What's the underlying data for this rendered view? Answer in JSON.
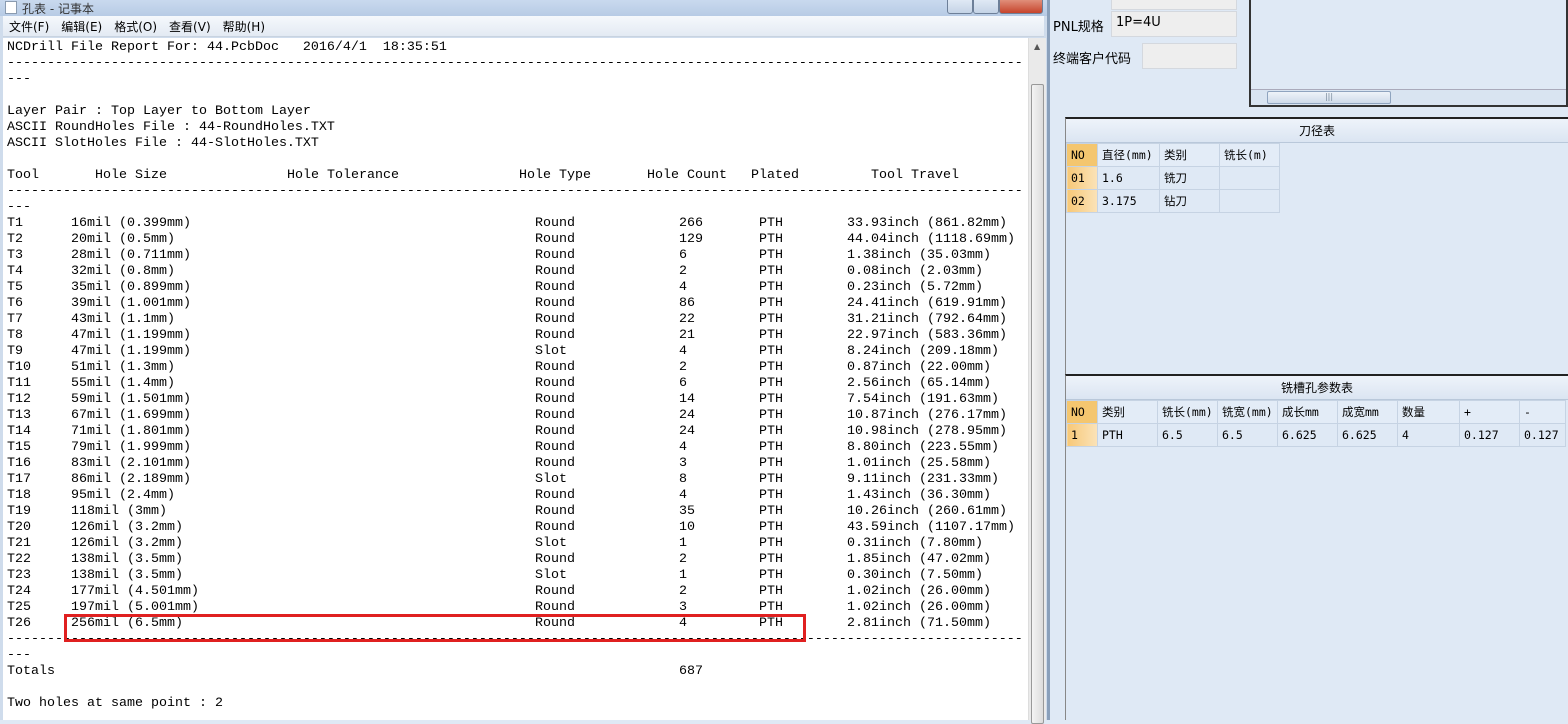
{
  "window": {
    "title": "孔表 - 记事本"
  },
  "menu": [
    "文件(F)",
    "编辑(E)",
    "格式(O)",
    "查看(V)",
    "帮助(H)"
  ],
  "report": {
    "header": "NCDrill File Report For: 44.PcbDoc   2016/4/1  18:35:51",
    "dash": "---",
    "layer_pair": "Layer Pair : Top Layer to Bottom Layer",
    "round_file": "ASCII RoundHoles File : 44-RoundHoles.TXT",
    "slot_file": "ASCII SlotHoles File : 44-SlotHoles.TXT",
    "columns": [
      "Tool",
      "Hole Size",
      "Hole Tolerance",
      "Hole Type",
      "Hole Count",
      "Plated",
      "Tool Travel"
    ],
    "rows": [
      [
        "T1",
        "16mil (0.399mm)",
        "Round",
        "266",
        "PTH",
        "33.93inch (861.82mm)"
      ],
      [
        "T2",
        "20mil (0.5mm)",
        "Round",
        "129",
        "PTH",
        "44.04inch (1118.69mm)"
      ],
      [
        "T3",
        "28mil (0.711mm)",
        "Round",
        "6",
        "PTH",
        "1.38inch (35.03mm)"
      ],
      [
        "T4",
        "32mil (0.8mm)",
        "Round",
        "2",
        "PTH",
        "0.08inch (2.03mm)"
      ],
      [
        "T5",
        "35mil (0.899mm)",
        "Round",
        "4",
        "PTH",
        "0.23inch (5.72mm)"
      ],
      [
        "T6",
        "39mil (1.001mm)",
        "Round",
        "86",
        "PTH",
        "24.41inch (619.91mm)"
      ],
      [
        "T7",
        "43mil (1.1mm)",
        "Round",
        "22",
        "PTH",
        "31.21inch (792.64mm)"
      ],
      [
        "T8",
        "47mil (1.199mm)",
        "Round",
        "21",
        "PTH",
        "22.97inch (583.36mm)"
      ],
      [
        "T9",
        "47mil (1.199mm)",
        "Slot",
        "4",
        "PTH",
        "8.24inch (209.18mm)"
      ],
      [
        "T10",
        "51mil (1.3mm)",
        "Round",
        "2",
        "PTH",
        "0.87inch (22.00mm)"
      ],
      [
        "T11",
        "55mil (1.4mm)",
        "Round",
        "6",
        "PTH",
        "2.56inch (65.14mm)"
      ],
      [
        "T12",
        "59mil (1.501mm)",
        "Round",
        "14",
        "PTH",
        "7.54inch (191.63mm)"
      ],
      [
        "T13",
        "67mil (1.699mm)",
        "Round",
        "24",
        "PTH",
        "10.87inch (276.17mm)"
      ],
      [
        "T14",
        "71mil (1.801mm)",
        "Round",
        "24",
        "PTH",
        "10.98inch (278.95mm)"
      ],
      [
        "T15",
        "79mil (1.999mm)",
        "Round",
        "4",
        "PTH",
        "8.80inch (223.55mm)"
      ],
      [
        "T16",
        "83mil (2.101mm)",
        "Round",
        "3",
        "PTH",
        "1.01inch (25.58mm)"
      ],
      [
        "T17",
        "86mil (2.189mm)",
        "Slot",
        "8",
        "PTH",
        "9.11inch (231.33mm)"
      ],
      [
        "T18",
        "95mil (2.4mm)",
        "Round",
        "4",
        "PTH",
        "1.43inch (36.30mm)"
      ],
      [
        "T19",
        "118mil (3mm)",
        "Round",
        "35",
        "PTH",
        "10.26inch (260.61mm)"
      ],
      [
        "T20",
        "126mil (3.2mm)",
        "Round",
        "10",
        "PTH",
        "43.59inch (1107.17mm)"
      ],
      [
        "T21",
        "126mil (3.2mm)",
        "Slot",
        "1",
        "PTH",
        "0.31inch (7.80mm)"
      ],
      [
        "T22",
        "138mil (3.5mm)",
        "Round",
        "2",
        "PTH",
        "1.85inch (47.02mm)"
      ],
      [
        "T23",
        "138mil (3.5mm)",
        "Slot",
        "1",
        "PTH",
        "0.30inch (7.50mm)"
      ],
      [
        "T24",
        "177mil (4.501mm)",
        "Round",
        "2",
        "PTH",
        "1.02inch (26.00mm)"
      ],
      [
        "T25",
        "197mil (5.001mm)",
        "Round",
        "3",
        "PTH",
        "1.02inch (26.00mm)"
      ],
      [
        "T26",
        "256mil (6.5mm)",
        "Round",
        "4",
        "PTH",
        "2.81inch (71.50mm)"
      ]
    ],
    "totals_label": "Totals",
    "totals_value": "687",
    "same_point": "Two holes at same point : 2"
  },
  "side": {
    "pnl_label": "PNL规格",
    "pnl_value": "1P=4U",
    "customer_label": "终端客户代码",
    "customer_value": "",
    "tool_table": {
      "title": "刀径表",
      "headers": [
        "NO",
        "直径(mm)",
        "类别",
        "铣长(m)"
      ],
      "rows": [
        [
          "01",
          "1.6",
          "铣刀",
          ""
        ],
        [
          "02",
          "3.175",
          "钻刀",
          ""
        ]
      ]
    },
    "slot_table": {
      "title": "铣槽孔参数表",
      "headers": [
        "NO",
        "类别",
        "铣长(mm)",
        "铣宽(mm)",
        "成长mm",
        "成宽mm",
        "数量",
        "+",
        "-"
      ],
      "rows": [
        [
          "1",
          "PTH",
          "6.5",
          "6.5",
          "6.625",
          "6.625",
          "4",
          "0.127",
          "0.127"
        ]
      ]
    }
  }
}
